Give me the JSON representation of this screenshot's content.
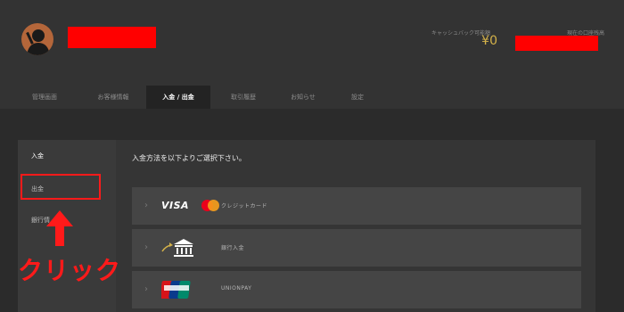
{
  "header": {
    "cashback_label": "キャッシュバック可能額",
    "cashback_value": "¥0",
    "balance_label": "現在の口座残高",
    "colors": {
      "accent_gold": "#d4b24a",
      "redaction": "#ff0000"
    }
  },
  "tabs": [
    {
      "label": "管理画面"
    },
    {
      "label": "お客様情報"
    },
    {
      "label": "入金 / 出金",
      "active": true
    },
    {
      "label": "取引履歴"
    },
    {
      "label": "お知らせ"
    },
    {
      "label": "設定"
    }
  ],
  "sidebar": {
    "items": [
      {
        "label": "入金",
        "active": true
      },
      {
        "label": "出金"
      },
      {
        "label": "銀行情"
      }
    ]
  },
  "content": {
    "title": "入金方法を以下よりご選択下さい。",
    "methods": [
      {
        "brand": "VISA",
        "icon": "mastercard-icon",
        "label": "クレジットカード"
      },
      {
        "icon": "bank-icon",
        "label": "銀行入金"
      },
      {
        "icon": "unionpay-icon",
        "label": "UNIONPAY"
      }
    ]
  },
  "annotation": {
    "text": "クリック",
    "color": "#ff1a1a"
  }
}
